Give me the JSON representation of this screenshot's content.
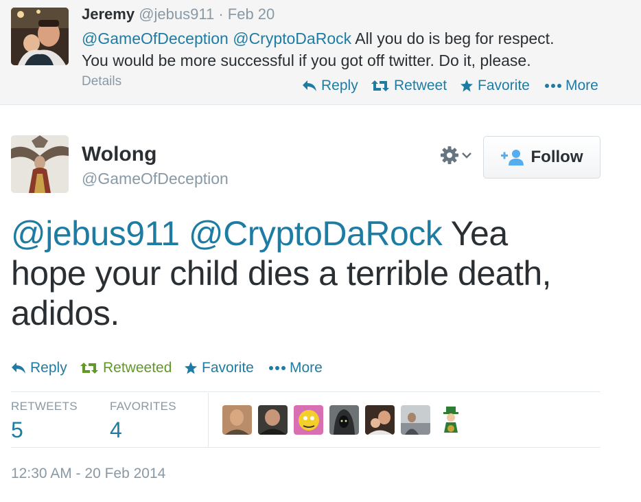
{
  "reply_tweet": {
    "fullname": "Jeremy",
    "username": "@jebus911",
    "separator": "·",
    "time": "Feb 20",
    "mention1": "@GameOfDeception",
    "mention2": "@CryptoDaRock",
    "text_line1": "All you do is beg for respect.",
    "text_line2": "You would be more successful if you got off twitter. Do it, please.",
    "details_label": "Details",
    "actions": {
      "reply": "Reply",
      "retweet": "Retweet",
      "favorite": "Favorite",
      "more": "More"
    },
    "avatar_icon": "user-avatar-photo"
  },
  "main_tweet": {
    "fullname": "Wolong",
    "username": "@GameOfDeception",
    "follow_label": "Follow",
    "mention1": "@jebus911",
    "mention2": "@CryptoDaRock",
    "text_line1": "Yea",
    "text_line2": "hope your child dies a terrible death,",
    "text_line3": "adidos.",
    "actions": {
      "reply": "Reply",
      "retweet": "Retweeted",
      "favorite": "Favorite",
      "more": "More"
    },
    "stats": {
      "retweets_label": "RETWEETS",
      "retweets_value": "5",
      "favorites_label": "FAVORITES",
      "favorites_value": "4"
    },
    "favoriter_avatars": [
      "avatar-1",
      "avatar-2",
      "avatar-3",
      "avatar-4",
      "avatar-5",
      "avatar-6",
      "avatar-7"
    ],
    "timestamp": "12:30 AM - 20 Feb 2014"
  },
  "colors": {
    "link_blue": "#1e7ca3",
    "retweeted_green": "#609928",
    "muted_gray": "#8899a6",
    "text_dark": "#292f33",
    "reply_bg": "#f5f5f5"
  }
}
